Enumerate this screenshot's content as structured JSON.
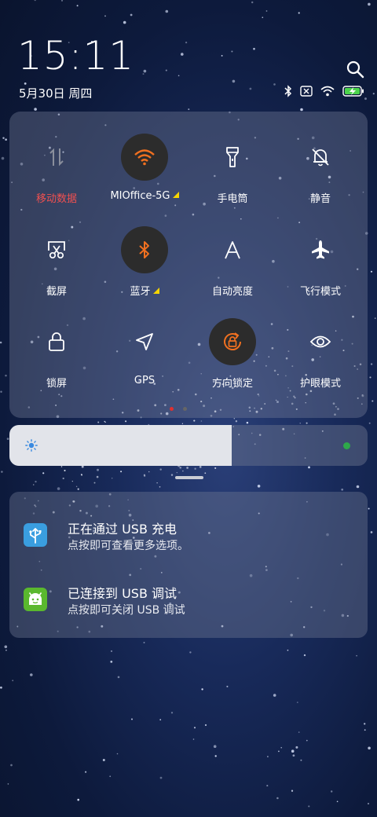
{
  "lockscreen": {
    "time": "15:11",
    "date": "5月30日 周四"
  },
  "status_icons": [
    "bluetooth-icon",
    "no-sim-icon",
    "wifi-icon",
    "battery-charging-icon"
  ],
  "quick_settings": {
    "tiles": [
      {
        "label": "移动数据",
        "icon": "mobile-data-icon",
        "active": false,
        "label_color": "#f05050"
      },
      {
        "label": "MIOffice-5G",
        "icon": "wifi-icon",
        "active": true,
        "has_more": true
      },
      {
        "label": "手电筒",
        "icon": "flashlight-icon",
        "active": false
      },
      {
        "label": "静音",
        "icon": "mute-bell-icon",
        "active": false
      },
      {
        "label": "截屏",
        "icon": "screenshot-scissors-icon",
        "active": false
      },
      {
        "label": "蓝牙",
        "icon": "bluetooth-icon",
        "active": true,
        "has_more": true
      },
      {
        "label": "自动亮度",
        "icon": "auto-brightness-icon",
        "active": false
      },
      {
        "label": "飞行模式",
        "icon": "airplane-icon",
        "active": false
      },
      {
        "label": "锁屏",
        "icon": "lock-icon",
        "active": false
      },
      {
        "label": "GPS",
        "icon": "gps-arrow-icon",
        "active": false
      },
      {
        "label": "方向锁定",
        "icon": "rotation-lock-icon",
        "active": true
      },
      {
        "label": "护眼模式",
        "icon": "eye-icon",
        "active": false
      }
    ],
    "active_color": "#f07020",
    "page_count": 2,
    "current_page": 1
  },
  "brightness": {
    "level": 0.62
  },
  "notifications": [
    {
      "title": "正在通过 USB 充电",
      "subtitle": "点按即可查看更多选项。",
      "icon": "usb-icon",
      "icon_color": "#3a9ee0"
    },
    {
      "title": "已连接到 USB 调试",
      "subtitle": "点按即可关闭 USB 调试",
      "icon": "android-icon",
      "icon_color": "#5ab82e"
    }
  ]
}
